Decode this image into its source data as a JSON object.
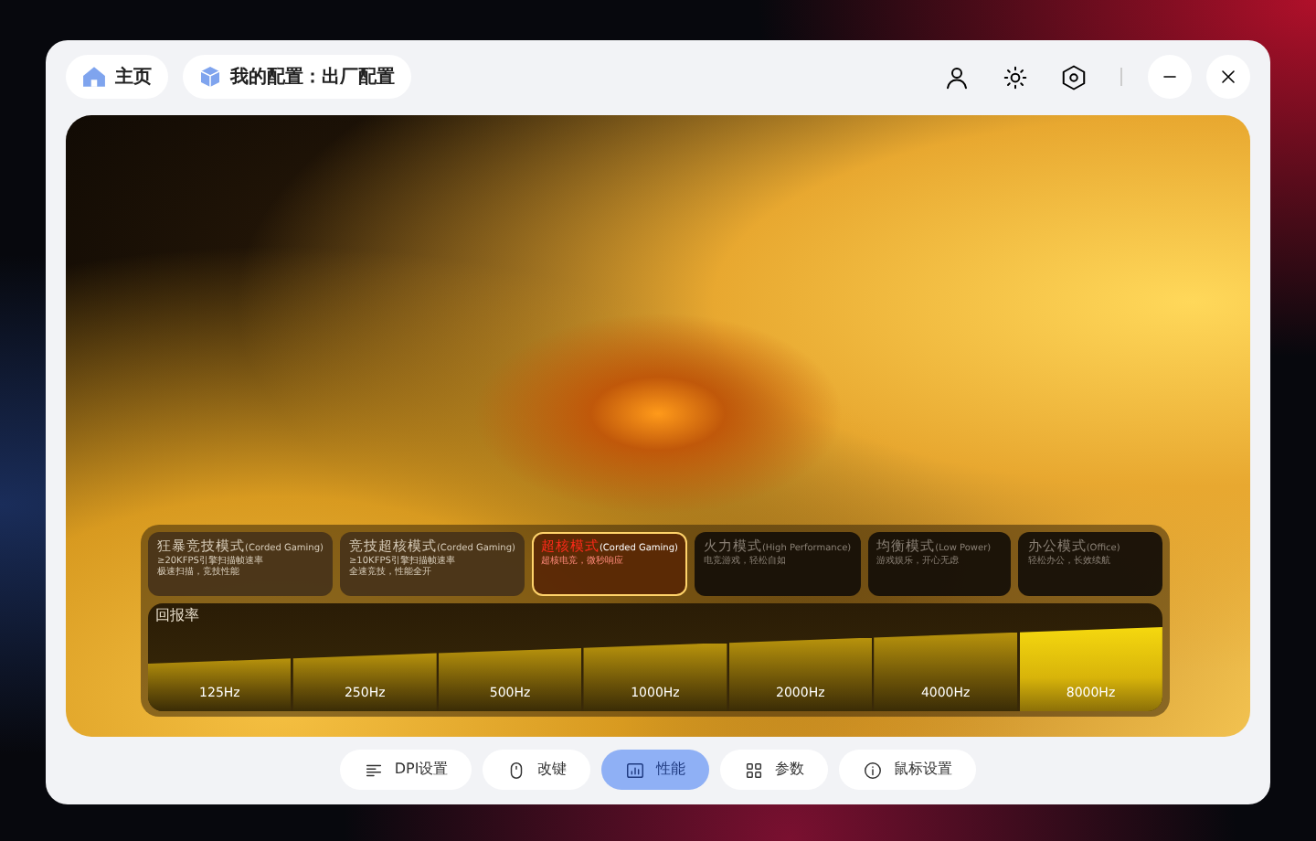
{
  "header": {
    "home": "主页",
    "profile": "我的配置：出厂配置"
  },
  "modes": [
    {
      "title": "狂暴竞技模式",
      "tag": "(Corded Gaming)",
      "line1": "≥20KFPS引擎扫描帧速率",
      "line2": "极速扫描，竞技性能",
      "selected": false,
      "disabled": false
    },
    {
      "title": "竞技超核模式",
      "tag": "(Corded Gaming)",
      "line1": "≥10KFPS引擎扫描帧速率",
      "line2": "全速竞技，性能全开",
      "selected": false,
      "disabled": false
    },
    {
      "title": "超核模式",
      "tag": "(Corded Gaming)",
      "line2": "超核电竞，微秒响应",
      "selected": true,
      "disabled": false
    },
    {
      "title": "火力模式",
      "tag": "(High Performance)",
      "line2": "电竞游戏，轻松自如",
      "selected": false,
      "disabled": true
    },
    {
      "title": "均衡模式",
      "tag": "(Low Power)",
      "line2": "游戏娱乐，开心无虑",
      "selected": false,
      "disabled": true
    },
    {
      "title": "办公模式",
      "tag": "(Office)",
      "line2": "轻松办公，长效续航",
      "selected": false,
      "disabled": true
    }
  ],
  "polling": {
    "label": "回报率",
    "rates": [
      {
        "label": "125Hz",
        "selected": false
      },
      {
        "label": "250Hz",
        "selected": false
      },
      {
        "label": "500Hz",
        "selected": false
      },
      {
        "label": "1000Hz",
        "selected": false
      },
      {
        "label": "2000Hz",
        "selected": false
      },
      {
        "label": "4000Hz",
        "selected": false
      },
      {
        "label": "8000Hz",
        "selected": true
      }
    ]
  },
  "nav": [
    {
      "label": "DPI设置",
      "kind": "lines",
      "selected": false
    },
    {
      "label": "改键",
      "kind": "mouse",
      "selected": false
    },
    {
      "label": "性能",
      "kind": "chart",
      "selected": true
    },
    {
      "label": "参数",
      "kind": "grid",
      "selected": false
    },
    {
      "label": "鼠标设置",
      "kind": "info",
      "selected": false
    }
  ]
}
